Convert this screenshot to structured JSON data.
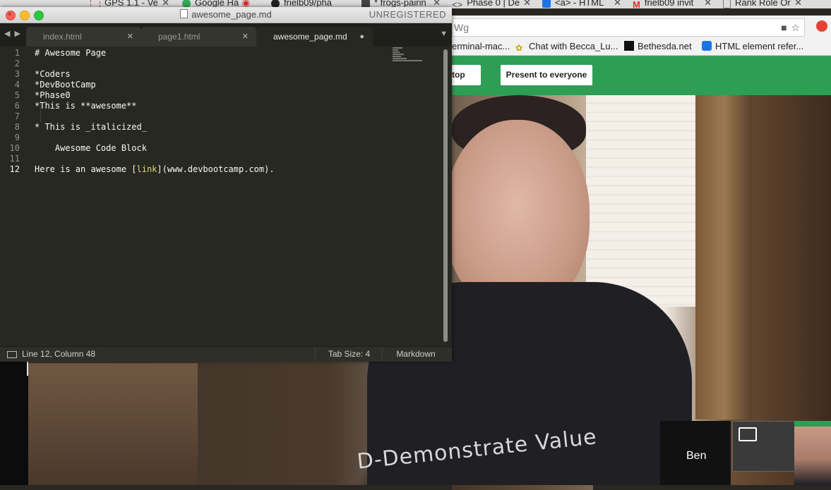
{
  "browser": {
    "tabs": [
      {
        "label": "GPS 1.1 - Ve",
        "color": "#cc3333"
      },
      {
        "label": "Google Ha",
        "color": "#33aa55"
      },
      {
        "label": "frielb09/pha",
        "color": "#222222"
      },
      {
        "label": "* frogs-pairin",
        "color": "#444444"
      },
      {
        "label": "Phase 0 | De",
        "color": "#555555"
      },
      {
        "label": "<a> - HTML",
        "color": "#1a73e8"
      },
      {
        "label": "frielb09 invit",
        "color": "#d93025"
      },
      {
        "label": "Rank Role Or",
        "color": "#777777"
      }
    ],
    "address_fragment": "Wg",
    "bookmarks": [
      {
        "label": "erminal-mac..."
      },
      {
        "label": "Chat with Becca_Lu..."
      },
      {
        "label": "Bethesda.net"
      },
      {
        "label": "HTML element refer..."
      }
    ]
  },
  "hangout": {
    "stop_label": "top",
    "present_label": "Present to everyone",
    "accent": "#2f9e55",
    "participant_name": "Ben",
    "shirt_text": "D-Demonstrate Value"
  },
  "editor": {
    "title": "awesome_page.md",
    "unregistered": "UNREGISTERED",
    "tabs": [
      {
        "label": "index.html",
        "close": "✕"
      },
      {
        "label": "page1.html",
        "close": "✕"
      },
      {
        "label": "awesome_page.md",
        "close": "●"
      }
    ],
    "lines": [
      {
        "n": "1",
        "text": "# Awesome Page"
      },
      {
        "n": "2",
        "text": ""
      },
      {
        "n": "3",
        "text": "*Coders"
      },
      {
        "n": "4",
        "text": "*DevBootCamp"
      },
      {
        "n": "5",
        "text": "*Phase0"
      },
      {
        "n": "6",
        "text": "*This is **awesome**"
      },
      {
        "n": "7",
        "text": ""
      },
      {
        "n": "8",
        "text": "* This is _italicized_"
      },
      {
        "n": "9",
        "text": ""
      },
      {
        "n": "10",
        "text": "    Awesome Code Block"
      },
      {
        "n": "11",
        "text": ""
      },
      {
        "n": "12",
        "text_before": "Here is an awesome [",
        "link": "link",
        "text_after": "](www.devbootcamp.com)."
      }
    ],
    "status": {
      "position": "Line 12, Column 48",
      "tab_size": "Tab Size: 4",
      "syntax": "Markdown"
    }
  }
}
